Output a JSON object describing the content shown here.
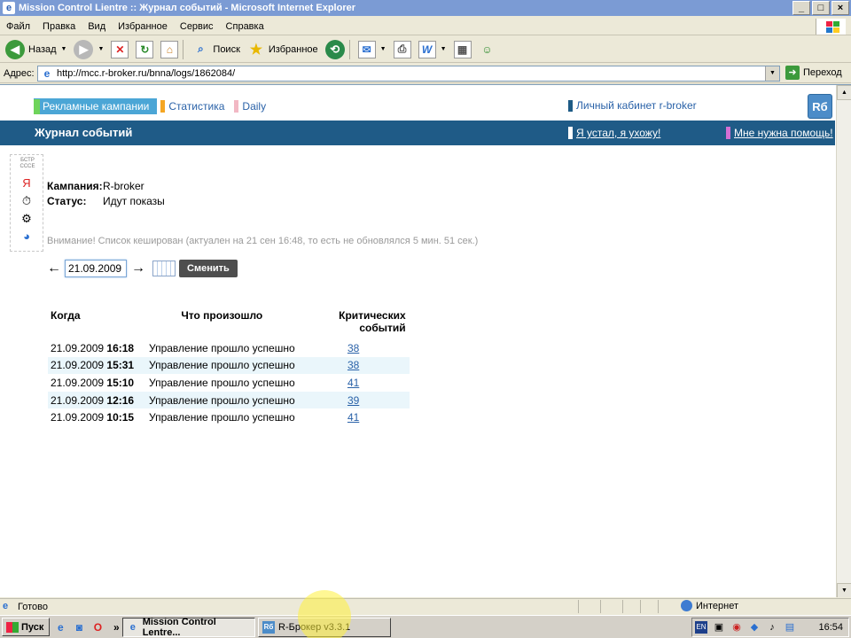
{
  "window": {
    "title": "Mission Control Lientre :: Журнал событий - Microsoft Internet Explorer",
    "minimize": "_",
    "maximize": "□",
    "close": "×"
  },
  "menu": [
    "Файл",
    "Правка",
    "Вид",
    "Избранное",
    "Сервис",
    "Справка"
  ],
  "toolbar": {
    "back": "Назад",
    "search": "Поиск",
    "favorites": "Избранное"
  },
  "address": {
    "label": "Адрес:",
    "url": "http://mcc.r-broker.ru/bnna/logs/1862084/",
    "go": "Переход"
  },
  "site": {
    "nav": [
      {
        "label": "Рекламные кампании",
        "color": "#6fd45a"
      },
      {
        "label": "Статистика",
        "color": "#f5a623"
      },
      {
        "label": "Daily",
        "color": "#f2b8c4"
      }
    ],
    "cabinet": "Личный кабинет r-broker",
    "logo": "Rб",
    "page_title": "Журнал событий",
    "logout": "Я устал, я ухожу!",
    "help": "Мне нужна помощь!",
    "help_mark_color": "#d46fd4",
    "logout_mark_color": "#ffffff"
  },
  "sidebar_icons": [
    "bstr-icon",
    "yandex-icon",
    "clock-icon",
    "gear-icon",
    "pie-chart-icon"
  ],
  "sidebar_icon_glyphs": {
    "bstr": "БСТР СССЕ",
    "yandex": "Я",
    "clock": "⏱",
    "gear": "⚙",
    "pie": "◕"
  },
  "campaign": {
    "label_campaign": "Кампания:",
    "value_campaign": "R-broker",
    "label_status": "Статус:",
    "value_status": "Идут показы"
  },
  "warning": "Внимание! Список кеширован (актуален на 21 сен 16:48, то есть не обновлялся 5 мин. 51 сек.)",
  "date_filter": {
    "prev_arrow": "←",
    "next_arrow": "→",
    "date": "21.09.2009",
    "change_button": "Сменить"
  },
  "events": {
    "columns": [
      "Когда",
      "Что произошло",
      "Критических событий"
    ],
    "rows": [
      {
        "date": "21.09.2009",
        "time": "16:18",
        "what": "Управление прошло успешно",
        "critical": "38"
      },
      {
        "date": "21.09.2009",
        "time": "15:31",
        "what": "Управление прошло успешно",
        "critical": "38"
      },
      {
        "date": "21.09.2009",
        "time": "15:10",
        "what": "Управление прошло успешно",
        "critical": "41"
      },
      {
        "date": "21.09.2009",
        "time": "12:16",
        "what": "Управление прошло успешно",
        "critical": "39"
      },
      {
        "date": "21.09.2009",
        "time": "10:15",
        "what": "Управление прошло успешно",
        "critical": "41"
      }
    ]
  },
  "statusbar": {
    "status": "Готово",
    "zone": "Интернет"
  },
  "taskbar": {
    "start": "Пуск",
    "chevron": "»",
    "tasks": [
      {
        "label": "Mission Control Lentre..."
      },
      {
        "label": "R-Брокер v3.3.1"
      }
    ],
    "lang": "EN",
    "clock": "16:54"
  }
}
